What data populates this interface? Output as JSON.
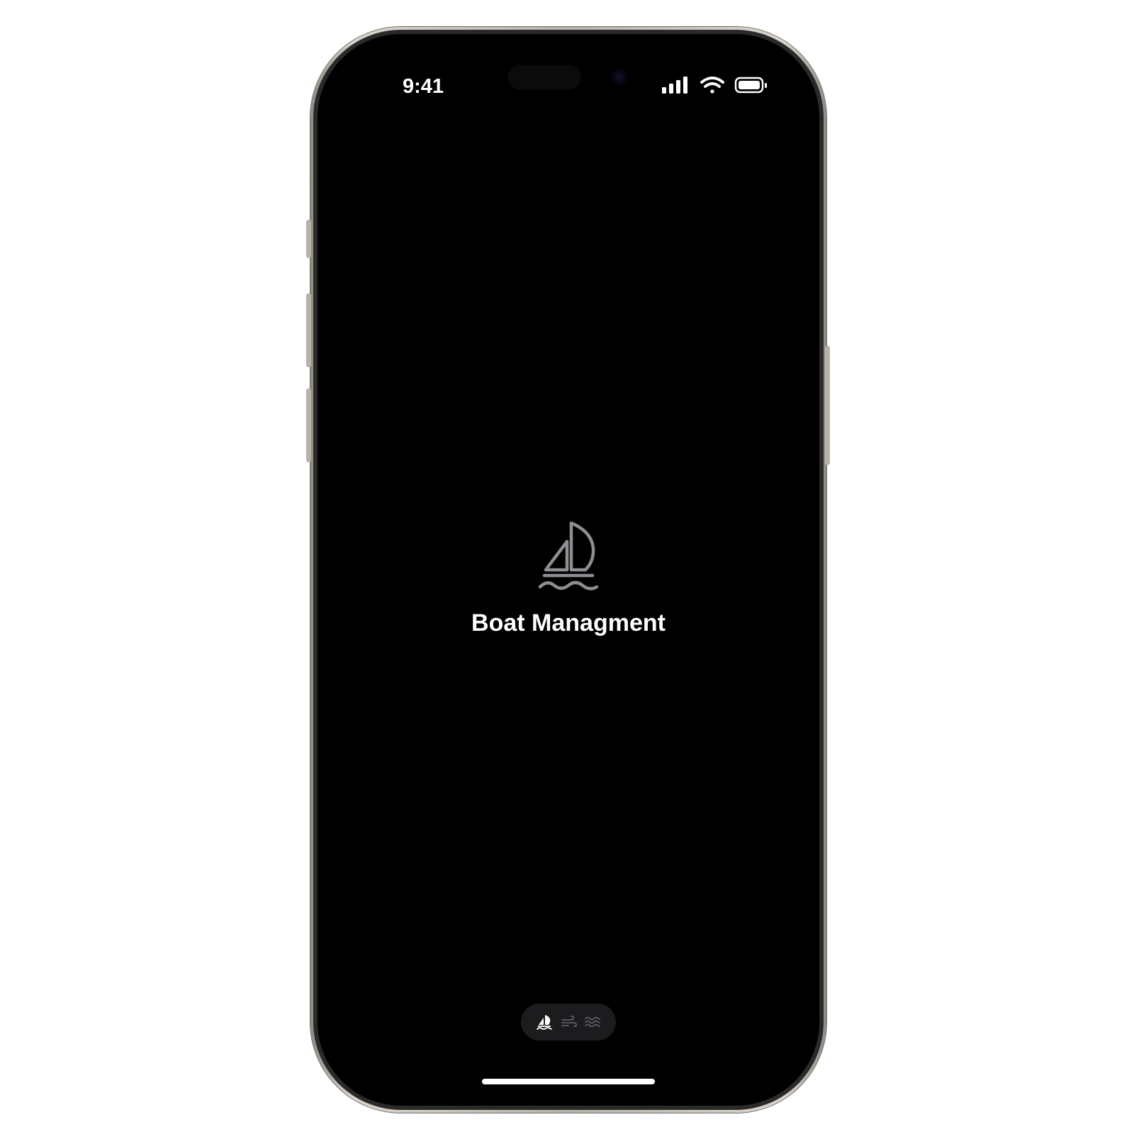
{
  "status_bar": {
    "time": "9:41"
  },
  "app": {
    "title": "Boat Managment"
  },
  "icons": {
    "splash": "sailboat-icon",
    "pager": [
      "sailboat-icon",
      "wind-icon",
      "waves-icon"
    ]
  },
  "colors": {
    "background": "#000000",
    "icon": "#8e8e93",
    "title": "#ffffff",
    "pager_bg": "#1c1c1e"
  }
}
